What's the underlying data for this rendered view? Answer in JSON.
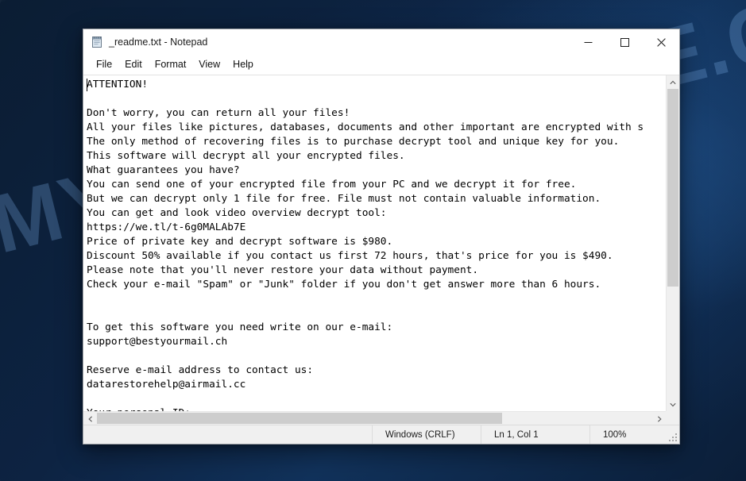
{
  "window": {
    "title": "_readme.txt - Notepad",
    "icon": "notepad-icon",
    "controls": {
      "minimize": "minimize-icon",
      "maximize": "maximize-icon",
      "close": "close-icon"
    }
  },
  "menubar": {
    "items": [
      {
        "label": "File"
      },
      {
        "label": "Edit"
      },
      {
        "label": "Format"
      },
      {
        "label": "View"
      },
      {
        "label": "Help"
      }
    ]
  },
  "editor": {
    "lines": [
      "ATTENTION!",
      "",
      "Don't worry, you can return all your files!",
      "All your files like pictures, databases, documents and other important are encrypted with s",
      "The only method of recovering files is to purchase decrypt tool and unique key for you.",
      "This software will decrypt all your encrypted files.",
      "What guarantees you have?",
      "You can send one of your encrypted file from your PC and we decrypt it for free.",
      "But we can decrypt only 1 file for free. File must not contain valuable information.",
      "You can get and look video overview decrypt tool:",
      "https://we.tl/t-6g0MALAb7E",
      "Price of private key and decrypt software is $980.",
      "Discount 50% available if you contact us first 72 hours, that's price for you is $490.",
      "Please note that you'll never restore your data without payment.",
      "Check your e-mail \"Spam\" or \"Junk\" folder if you don't get answer more than 6 hours.",
      "",
      "",
      "To get this software you need write on our e-mail:",
      "support@bestyourmail.ch",
      "",
      "Reserve e-mail address to contact us:",
      "datarestorehelp@airmail.cc",
      "",
      "Your personal ID:"
    ]
  },
  "scrollbars": {
    "vertical": {
      "up_arrow": "chevron-up-icon",
      "down_arrow": "chevron-down-icon",
      "thumb_size_pct": 64,
      "thumb_pos_pct": 0
    },
    "horizontal": {
      "left_arrow": "chevron-left-icon",
      "right_arrow": "chevron-right-icon",
      "thumb_size_pct": 73,
      "thumb_pos_pct": 0
    }
  },
  "statusbar": {
    "line_ending": "Windows (CRLF)",
    "cursor_position": "Ln 1, Col 1",
    "zoom": "100%",
    "resize_grip": "resize-grip-icon"
  },
  "desktop": {
    "watermark": "MYANTISPYWARE.COM"
  },
  "colors": {
    "desktop_base": "#0d2342",
    "desktop_glow": "#2c68aa",
    "window_bg": "#ffffff",
    "statusbar_bg": "#f0f0f0",
    "scrollbar_thumb": "#cdcdcd",
    "text": "#000000",
    "watermark": "#78aae1",
    "close_hover": "#e81123"
  }
}
